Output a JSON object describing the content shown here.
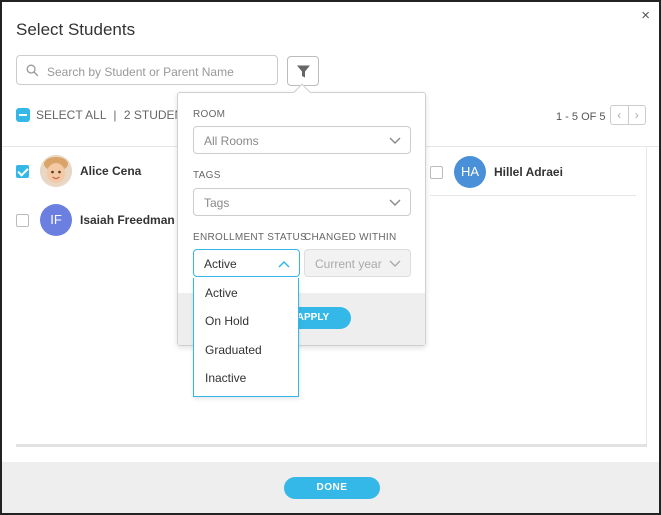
{
  "modal": {
    "title": "Select Students",
    "close_symbol": "×"
  },
  "search": {
    "placeholder": "Search by Student or Parent Name",
    "icon": "search-icon"
  },
  "filter_button": {
    "icon": "filter-funnel-icon"
  },
  "toolbar": {
    "select_all_label": "SELECT ALL",
    "separator": "|",
    "selected_count": "2 STUDENT",
    "pager_text": "1 - 5 OF 5",
    "prev_symbol": "‹",
    "next_symbol": "›"
  },
  "students": [
    {
      "name": "Alice Cena",
      "initials": "",
      "checked": true,
      "avatar_color": "#f3c9a0"
    },
    {
      "name": "Hillel Adraei",
      "initials": "HA",
      "checked": false,
      "avatar_color": "#4a90d9"
    },
    {
      "name": "Isaiah Freedman",
      "initials": "IF",
      "checked": false,
      "avatar_color": "#6b7fe0"
    }
  ],
  "filter_panel": {
    "room_label": "ROOM",
    "room_value": "All Rooms",
    "tags_label": "TAGS",
    "tags_value": "Tags",
    "enrollment_label": "ENROLLMENT STATUS",
    "enrollment_value": "Active",
    "changed_label": "CHANGED WITHIN",
    "changed_value": "Current year",
    "apply_label": "APPLY"
  },
  "enrollment_options": [
    "Active",
    "On Hold",
    "Graduated",
    "Inactive"
  ],
  "footer": {
    "done_label": "DONE"
  },
  "colors": {
    "accent": "#34b8e8"
  }
}
